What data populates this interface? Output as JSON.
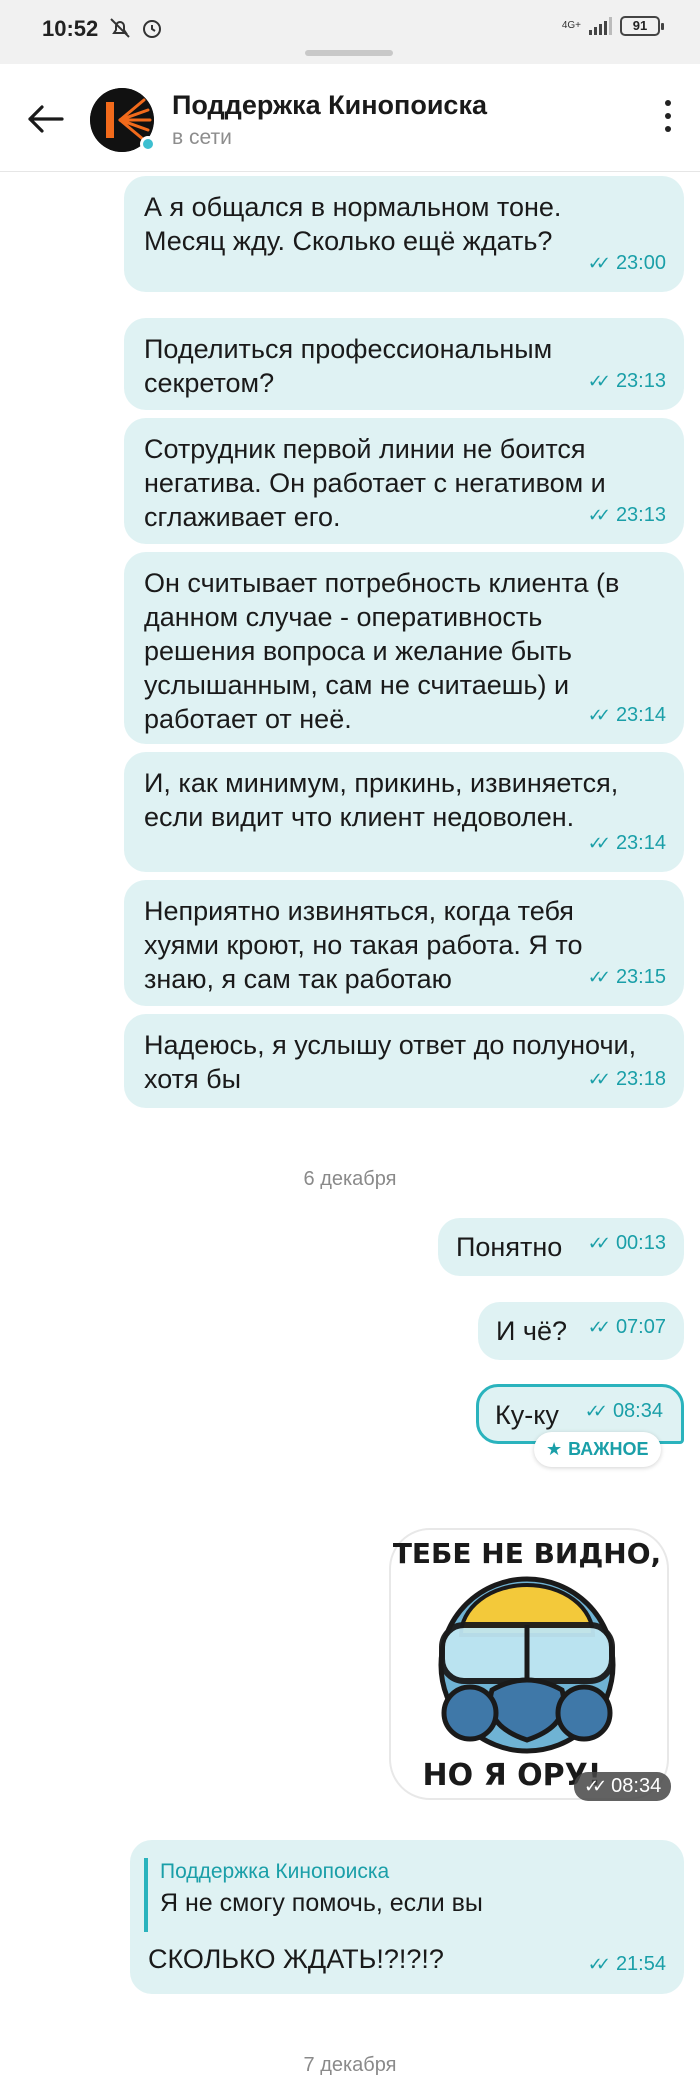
{
  "status_bar": {
    "time": "10:52",
    "network": "4G+",
    "battery": "91"
  },
  "header": {
    "title": "Поддержка Кинопоиска",
    "status": "в сети"
  },
  "messages": [
    {
      "text": "А я общался в нормальном тоне.\nМесяц жду. Сколько ещё ждать?",
      "time": "23:00"
    },
    {
      "text": "Поделиться профессиональным\nсекретом?",
      "time": "23:13"
    },
    {
      "text": "Сотрудник первой линии не боится\nнегатива. Он работает с негативом и\nсглаживает его.",
      "time": "23:13"
    },
    {
      "text": "Он считывает потребность клиента (в\nданном случае - оперативность\nрешения вопроса и желание быть\nуслышанным, сам не считаешь) и\nработает от неё.",
      "time": "23:14"
    },
    {
      "text": "И, как минимум, прикинь, извиняется,\nесли видит что клиент недоволен.",
      "time": "23:14"
    },
    {
      "text": "Неприятно извиняться, когда тебя\nхуями кроют, но такая работа. Я то\nзнаю, я сам так работаю",
      "time": "23:15"
    },
    {
      "text": "Надеюсь, я услышу ответ до полуночи,\nхотя бы",
      "time": "23:18"
    }
  ],
  "date_separators": [
    "6 декабря",
    "7 декабря"
  ],
  "short_messages": [
    {
      "text": "Понятно",
      "time": "00:13"
    },
    {
      "text": "И чё?",
      "time": "07:07"
    },
    {
      "text": "Ку-ку",
      "time": "08:34"
    }
  ],
  "important_badge": "ВАЖНОЕ",
  "sticker": {
    "line1": "ТЕБЕ НЕ ВИДНО,",
    "line2": "НО Я ОРУ!",
    "time": "08:34"
  },
  "reply": {
    "quote_author": "Поддержка Кинопоиска",
    "quote_text": "Я не смогу помочь, если вы",
    "text": "СКОЛЬКО ЖДАТЬ!?!?!?",
    "time": "21:54"
  },
  "colors": {
    "bubble": "#dff2f3",
    "accent": "#1a9fa8",
    "brand_orange": "#f26a1b"
  }
}
